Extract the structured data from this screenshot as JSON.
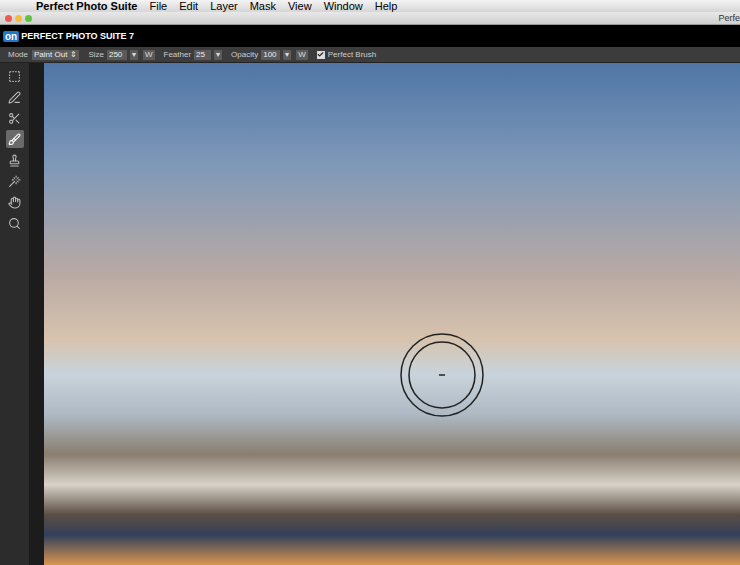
{
  "menu_bar": {
    "apple": "",
    "app": "Perfect Photo Suite",
    "items": [
      "File",
      "Edit",
      "Layer",
      "Mask",
      "View",
      "Window",
      "Help"
    ]
  },
  "window": {
    "title": "Perfe"
  },
  "app_header": {
    "logo": "on",
    "title": "PERFECT PHOTO SUITE 7"
  },
  "toolbar": {
    "mode": {
      "label": "Mode",
      "value": "Paint Out",
      "arrow": "⇕"
    },
    "size": {
      "label": "Size",
      "value": "250",
      "arrow": "▾",
      "extra": "W"
    },
    "feather": {
      "label": "Feather",
      "value": "25",
      "arrow": "▾"
    },
    "opacity": {
      "label": "Opacity",
      "value": "100",
      "arrow": "▾",
      "extra": "W"
    },
    "perfect_brush": {
      "label": "Perfect Brush",
      "checked": true
    }
  },
  "tools": [
    {
      "kind": "marquee",
      "selected": false
    },
    {
      "kind": "line",
      "selected": false
    },
    {
      "kind": "scissors",
      "selected": false
    },
    {
      "kind": "brush",
      "selected": true
    },
    {
      "kind": "stamp",
      "selected": false
    },
    {
      "kind": "wand",
      "selected": false
    },
    {
      "kind": "hand",
      "selected": false
    },
    {
      "kind": "zoom",
      "selected": false
    }
  ]
}
